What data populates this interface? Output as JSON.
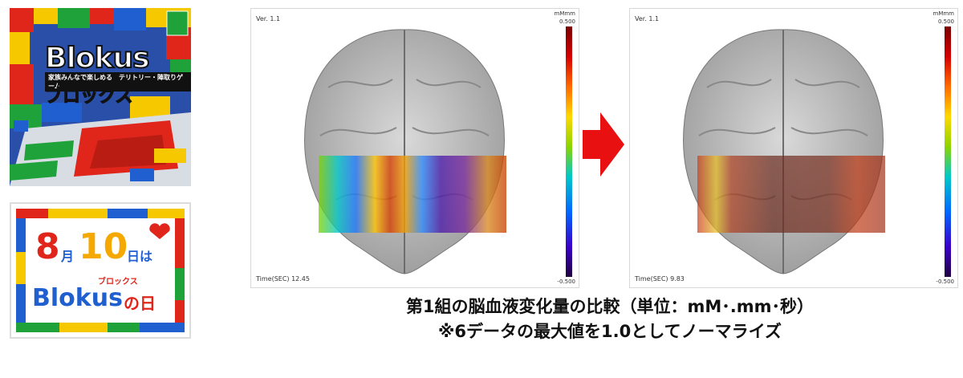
{
  "box_art": {
    "title": "Blokus",
    "subtitle": "家族みんなで楽しめる　テリトリー・陣取りゲーム",
    "kana": "ブロックス",
    "colors": {
      "red": "#e0261b",
      "blue": "#1f5fd0",
      "yellow": "#f5c800",
      "green": "#1fa23a"
    }
  },
  "day_logo": {
    "month_num": "8",
    "month_char": "月",
    "day_num": "10",
    "day_char": "日は",
    "kana": "ブロックス",
    "brand": "Blokus",
    "suffix": "の日"
  },
  "panels": [
    {
      "version": "Ver. 1.1",
      "unit": "mMmm",
      "max": "0.500",
      "min": "-0.500",
      "time": "Time(SEC)  12.45"
    },
    {
      "version": "Ver. 1.1",
      "unit": "mMmm",
      "max": "0.500",
      "min": "-0.500",
      "time": "Time(SEC)  9.83"
    }
  ],
  "arrow_color": "#e81010",
  "caption": {
    "line1": "第1組の脳血液変化量の比較（単位：mM･.mm･秒）",
    "line2": "※6データの最大値を1.0としてノーマライズ"
  }
}
